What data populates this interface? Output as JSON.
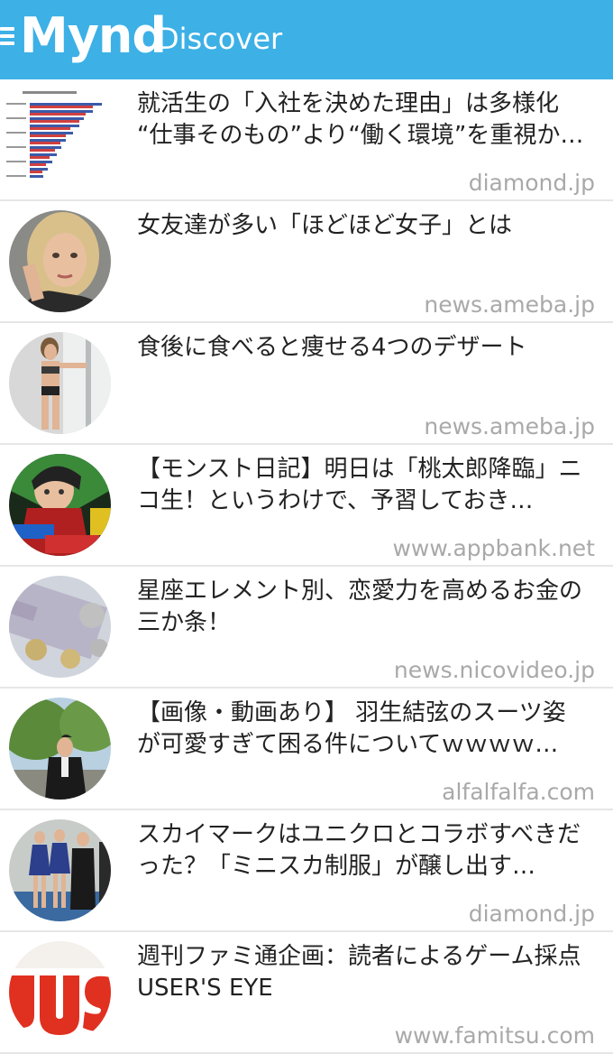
{
  "header": {
    "logo": "Mynd",
    "section": "Discover",
    "color": "#3db0e6"
  },
  "articles": [
    {
      "title": "就活生の「入社を決めた理由」は多様化 “仕事そのもの”より“働く環境”を重視か…",
      "source": "diamond.jp",
      "thumb": "bar-chart-thumbnail"
    },
    {
      "title": "女友達が多い「ほどほど女子」とは",
      "source": "news.ameba.jp",
      "thumb": "woman-portrait-thumbnail"
    },
    {
      "title": "食後に食べると痩せる4つのデザート",
      "source": "news.ameba.jp",
      "thumb": "woman-swimsuit-thumbnail"
    },
    {
      "title": "【モンスト日記】明日は「桃太郎降臨」ニコ生！というわけで、予習しておき…",
      "source": "www.appbank.net",
      "thumb": "game-character-thumbnail"
    },
    {
      "title": "星座エレメント別、恋愛力を高めるお金の三か条！",
      "source": "news.nicovideo.jp",
      "thumb": "euro-money-thumbnail"
    },
    {
      "title": "【画像・動画あり】 羽生結弦のスーツ姿が可愛すぎて困る件についてｗｗｗｗ…",
      "source": "alfalfalfa.com",
      "thumb": "man-in-suit-thumbnail"
    },
    {
      "title": "スカイマークはユニクロとコラボすべきだった？「ミニスカ制服」が醸し出す…",
      "source": "diamond.jp",
      "thumb": "flight-attendants-thumbnail"
    },
    {
      "title": "週刊ファミ通企画：読者によるゲーム採点 USER'S EYE",
      "source": "www.famitsu.com",
      "thumb": "users-logo-thumbnail"
    }
  ]
}
